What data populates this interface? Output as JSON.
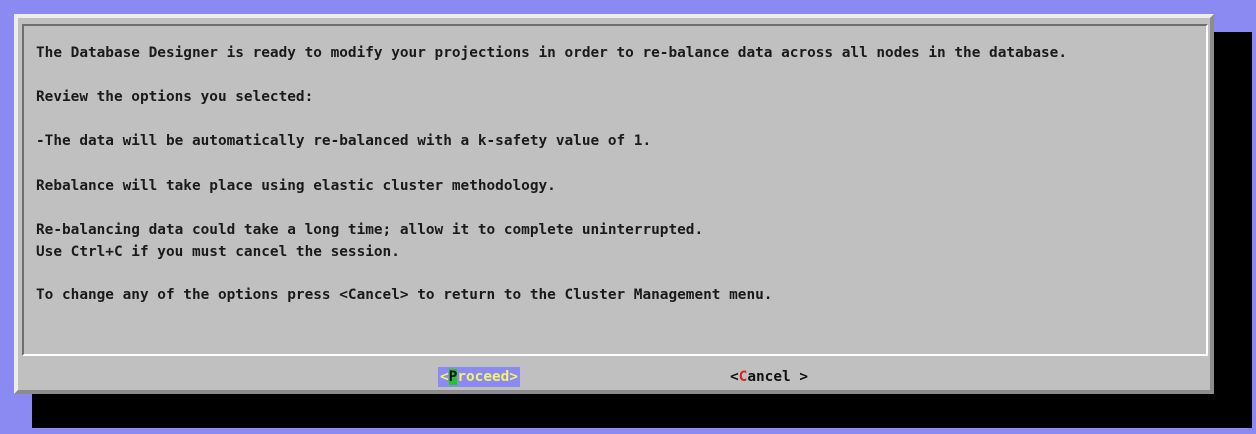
{
  "colors": {
    "screen_background": "#8a8af2",
    "dialog_background": "#c0c0c0",
    "dialog_shadow": "#000000",
    "text": "#1a1a1a",
    "selected_button_background": "#8a8af2",
    "selected_button_text": "#f4f46a",
    "hotkey_selected_background": "#1ec81e",
    "hotkey_unselected": "#e01e1e"
  },
  "message": {
    "line1": "The Database Designer is ready to modify your projections in order to re-balance data across all nodes in the database.",
    "line2": "Review the options you selected:",
    "line3": "-The data will be automatically re-balanced with a k-safety value of 1.",
    "line4": "Rebalance will take place using elastic cluster methodology.",
    "line5": "Re-balancing data could take a long time; allow it to complete uninterrupted.",
    "line6": "Use Ctrl+C if you must cancel the session.",
    "line7": "To change any of the options press <Cancel> to return to the Cluster Management menu."
  },
  "buttons": {
    "proceed": {
      "open": "<",
      "hotkey": "P",
      "rest": "roceed",
      "close": ">",
      "selected": true
    },
    "cancel": {
      "open": "<",
      "hotkey": "C",
      "rest": "ancel",
      "close": " >",
      "selected": false
    }
  }
}
